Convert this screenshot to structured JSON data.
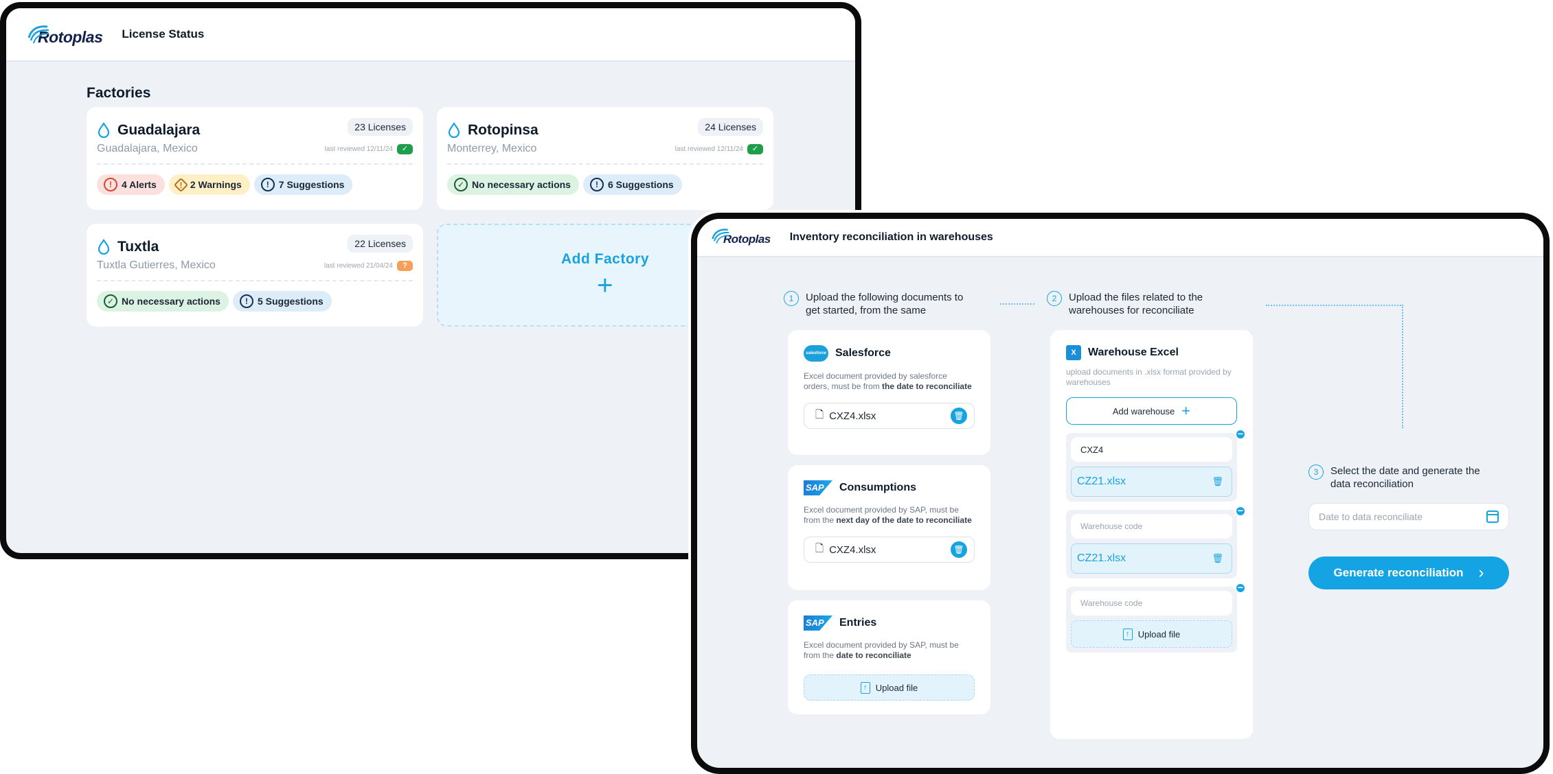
{
  "license_window": {
    "brand": "Rotoplas",
    "title": "License Status",
    "section_heading": "Factories",
    "factories": [
      {
        "name": "Guadalajara",
        "licenses": "23 Licenses",
        "location": "Guadalajara, Mexico",
        "reviewed": "last reviewed 12/11/24",
        "review_status": "ok",
        "chips": [
          {
            "kind": "alert",
            "label": "4 Alerts"
          },
          {
            "kind": "warning",
            "label": "2 Warnings"
          },
          {
            "kind": "suggestion",
            "label": "7 Suggestions"
          }
        ]
      },
      {
        "name": "Rotopinsa",
        "licenses": "24 Licenses",
        "location": "Monterrey, Mexico",
        "reviewed": "last reviewed 12/11/24",
        "review_status": "ok",
        "chips": [
          {
            "kind": "ok",
            "label": "No necessary actions"
          },
          {
            "kind": "suggestion",
            "label": "6 Suggestions"
          }
        ]
      },
      {
        "name": "Tuxtla",
        "licenses": "22 Licenses",
        "location": "Tuxtla Gutierres, Mexico",
        "reviewed": "last reviewed 21/04/24",
        "review_status": "pending",
        "chips": [
          {
            "kind": "ok",
            "label": "No necessary actions"
          },
          {
            "kind": "suggestion",
            "label": "5 Suggestions"
          }
        ]
      }
    ],
    "add_factory_label": "Add Factory",
    "add_factory_plus": "+"
  },
  "reconciliation_window": {
    "brand": "Rotoplas",
    "title": "Inventory reconciliation in warehouses",
    "steps": [
      {
        "num": "1",
        "text": "Upload the following documents to get started, from the same"
      },
      {
        "num": "2",
        "text": "Upload the files related to the warehouses for reconciliate"
      },
      {
        "num": "3",
        "text": "Select the date and generate the data reconciliation"
      }
    ],
    "documents": [
      {
        "logo": "salesforce",
        "logo_text": "salesforce",
        "title": "Salesforce",
        "desc_plain": "Excel document provided by salesforce orders, must be from ",
        "desc_bold": "the date to reconciliate",
        "file": "CXZ4.xlsx"
      },
      {
        "logo": "sap",
        "logo_text": "SAP",
        "title": "Consumptions",
        "desc_plain": "Excel document provided by SAP, must be from the ",
        "desc_bold": "next day of the date to reconciliate",
        "file": "CXZ4.xlsx"
      },
      {
        "logo": "sap",
        "logo_text": "SAP",
        "title": "Entries",
        "desc_plain": "Excel document provided by SAP, must be from the ",
        "desc_bold": "date to reconciliate",
        "upload_label": "Upload file"
      }
    ],
    "warehouse": {
      "logo_text": "X",
      "title": "Warehouse Excel",
      "desc": "upload documents in .xlsx format provided by warehouses",
      "add_label": "Add warehouse",
      "add_plus": "+",
      "code_placeholder": "Warehouse code",
      "entries": [
        {
          "code": "CXZ4",
          "file": "CZ21.xlsx"
        },
        {
          "code": "",
          "file": "CZ21.xlsx"
        },
        {
          "code": "",
          "upload_label": "Upload file"
        }
      ]
    },
    "date_placeholder": "Date to data reconciliate",
    "generate_label": "Generate reconciliation",
    "colors": {
      "accent": "#14a3e3",
      "success": "#1e9e4a",
      "pending": "#f4a05a"
    }
  }
}
